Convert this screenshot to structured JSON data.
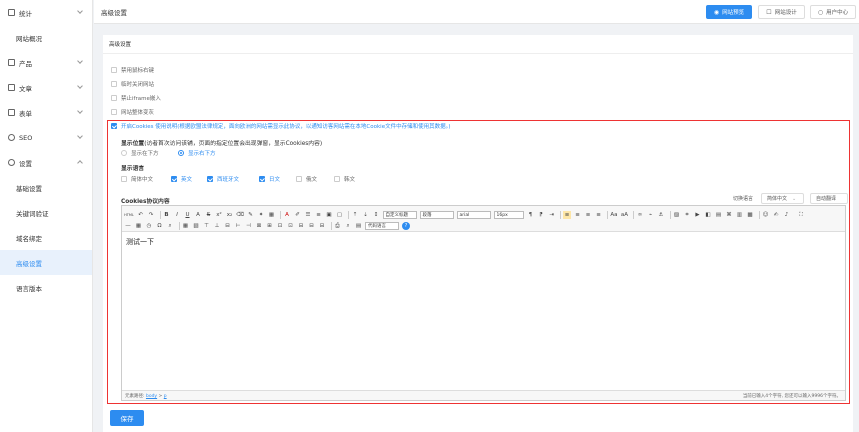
{
  "sidebar": {
    "items": [
      {
        "label": "统计",
        "icon": "chart-icon"
      },
      {
        "label": "网站概况",
        "icon": ""
      },
      {
        "label": "产品",
        "icon": "product-icon"
      },
      {
        "label": "文章",
        "icon": "article-icon"
      },
      {
        "label": "表单",
        "icon": "form-icon"
      },
      {
        "label": "SEO",
        "icon": "seo-icon"
      },
      {
        "label": "设置",
        "icon": "gear-icon"
      },
      {
        "label": "基础设置",
        "icon": ""
      },
      {
        "label": "关键词验证",
        "icon": ""
      },
      {
        "label": "域名绑定",
        "icon": ""
      },
      {
        "label": "高级设置",
        "icon": ""
      },
      {
        "label": "语言版本",
        "icon": ""
      }
    ]
  },
  "topbar": {
    "title": "高级设置",
    "preview_label": "网站预览",
    "design_label": "网站设计",
    "user_center_label": "用户中心"
  },
  "card": {
    "title": "高级设置",
    "options": [
      {
        "label": "禁用鼠标右键",
        "checked": false
      },
      {
        "label": "临时关闭网站",
        "checked": false
      },
      {
        "label": "禁止iframe嵌入",
        "checked": false
      },
      {
        "label": "网站整体变灰",
        "checked": false
      }
    ],
    "cookies_option": "开启Cookies 使用说明(根据欧盟法律规定，面向欧洲的网站需显示此协议，以通知访客网站需在本地Cookie文件中存储和使用其数据。)",
    "display_pos_label": "显示位置",
    "display_pos_hint": "(访者首次访问该铺，页面的指定位置会出现弹窗，显示Cookies内容)",
    "pos_options": [
      "显示在下方",
      "显示右下方"
    ],
    "lang_label": "显示语言",
    "languages": [
      {
        "label": "简体中文",
        "checked": false
      },
      {
        "label": "英文",
        "checked": true
      },
      {
        "label": "西班牙文",
        "checked": true
      },
      {
        "label": "日文",
        "checked": true
      },
      {
        "label": "俄文",
        "checked": false
      },
      {
        "label": "韩文",
        "checked": false
      }
    ],
    "content_label": "Cookies协议内容",
    "switch_lang_label": "切换语言",
    "switch_lang_value": "简体中文",
    "auto_translate_label": "自动翻译",
    "editor_text": "测试一下",
    "footer_path_label": "元素路径:",
    "footer_path_body": "body",
    "footer_path_sep": ">",
    "footer_path_p": "p",
    "footer_count": "当前已输入4个字符, 您还可以输入9996个字符。",
    "save_label": "保存"
  },
  "toolbar": {
    "html_label": "HTML",
    "custom_title": "自定义标题",
    "paragraph": "段落",
    "font": "arial",
    "size": "16px",
    "code_lang": "代码语言"
  }
}
